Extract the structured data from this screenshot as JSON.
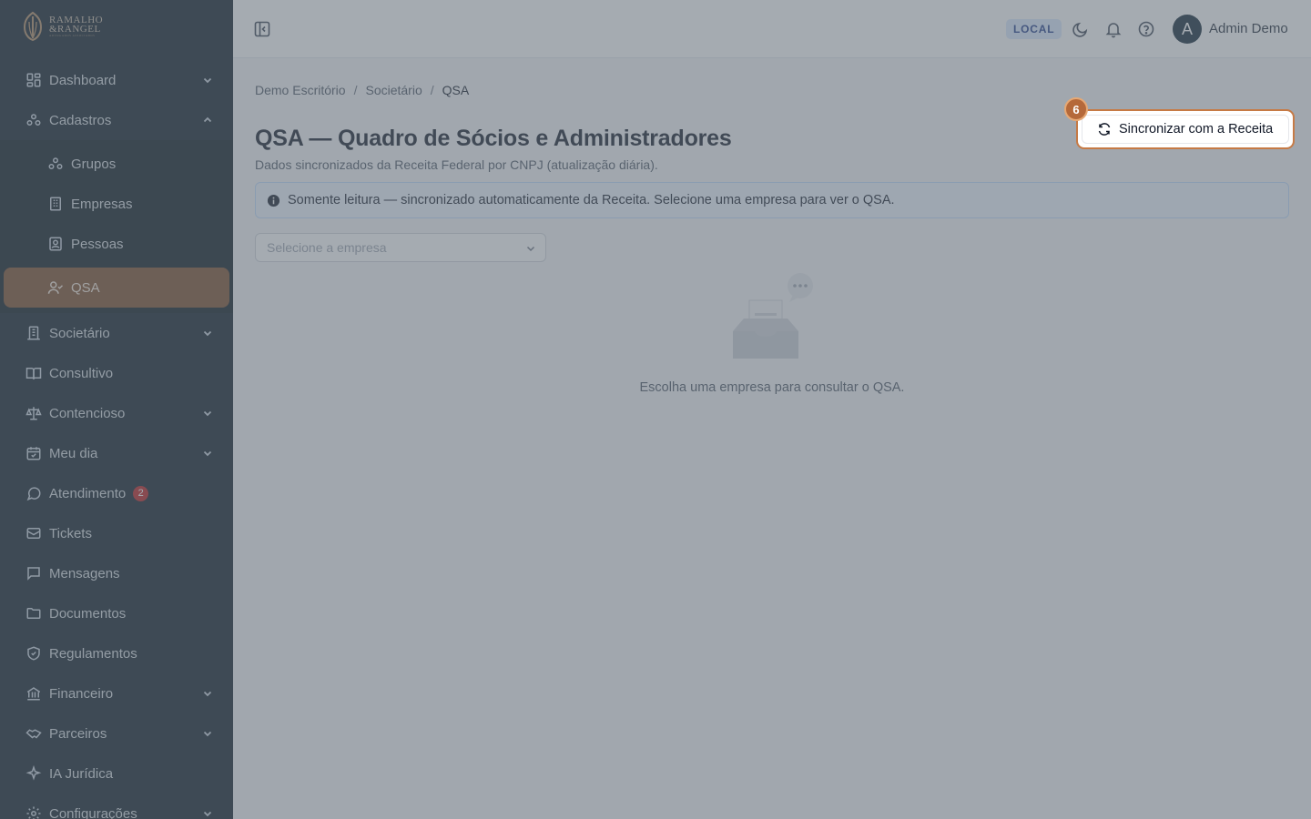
{
  "brand": {
    "name_line1": "RAMALHO",
    "name_line2": "&RANGEL",
    "tagline": "ADVOGADOS ASSOCIADOS"
  },
  "sidebar": {
    "items": [
      {
        "label": "Dashboard",
        "icon": "dashboard-icon"
      },
      {
        "label": "Cadastros",
        "icon": "cadastros-icon"
      },
      {
        "label": "Grupos",
        "icon": "grupos-icon"
      },
      {
        "label": "Empresas",
        "icon": "building-icon"
      },
      {
        "label": "Pessoas",
        "icon": "contact-icon"
      },
      {
        "label": "QSA",
        "icon": "user-check-icon"
      },
      {
        "label": "Societário",
        "icon": "societario-icon"
      },
      {
        "label": "Consultivo",
        "icon": "book-icon"
      },
      {
        "label": "Contencioso",
        "icon": "scale-icon"
      },
      {
        "label": "Meu dia",
        "icon": "calendar-icon"
      },
      {
        "label": "Atendimento",
        "icon": "chat-icon",
        "badge": "2"
      },
      {
        "label": "Tickets",
        "icon": "ticket-icon"
      },
      {
        "label": "Mensagens",
        "icon": "message-icon"
      },
      {
        "label": "Documentos",
        "icon": "folder-icon"
      },
      {
        "label": "Regulamentos",
        "icon": "shield-icon"
      },
      {
        "label": "Financeiro",
        "icon": "bank-icon"
      },
      {
        "label": "Parceiros",
        "icon": "handshake-icon"
      },
      {
        "label": "IA Jurídica",
        "icon": "sparkles-icon"
      },
      {
        "label": "Configurações",
        "icon": "gear-icon"
      }
    ]
  },
  "topbar": {
    "env": "LOCAL",
    "avatar_initial": "A",
    "user_name": "Admin Demo"
  },
  "breadcrumb": [
    "Demo Escritório",
    "Societário",
    "QSA"
  ],
  "page": {
    "title": "QSA — Quadro de Sócios e Administradores",
    "subtitle": "Dados sincronizados da Receita Federal por CNPJ (atualização diária).",
    "info": "Somente leitura — sincronizado automaticamente da Receita. Selecione uma empresa para ver o QSA.",
    "select_placeholder": "Selecione a empresa",
    "empty_text": "Escolha uma empresa para consultar o QSA.",
    "sync_button": "Sincronizar com a Receita",
    "step_number": "6"
  },
  "colors": {
    "sidebar_bg": "#0b1a24",
    "active_item": "#7a4a28",
    "highlight": "#c67a45",
    "badge": "#b91c1c"
  }
}
